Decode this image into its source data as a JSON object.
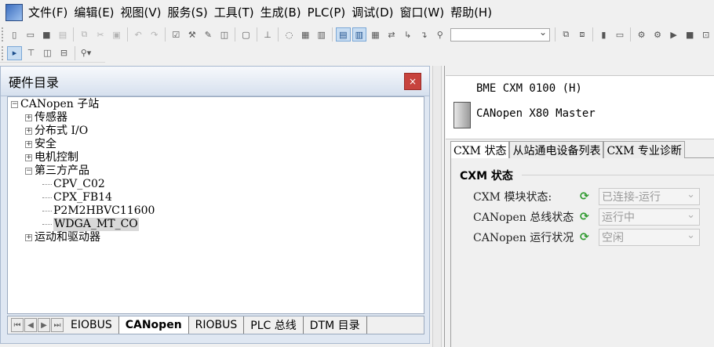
{
  "menu": {
    "items": [
      "文件(F)",
      "编辑(E)",
      "视图(V)",
      "服务(S)",
      "工具(T)",
      "生成(B)",
      "PLC(P)",
      "调试(D)",
      "窗口(W)",
      "帮助(H)"
    ]
  },
  "toolbar": {
    "icons": [
      "new-icon",
      "open-icon",
      "save-icon",
      "print-icon",
      "copy-icon",
      "cut-icon",
      "paste-icon",
      "undo-icon",
      "redo-icon",
      "check-icon",
      "tools-icon",
      "wrench-icon",
      "analyze-icon",
      "monitor-icon",
      "build-icon",
      "project-icon",
      "grid-icon",
      "variables-icon",
      "hardware-catalog-icon",
      "dtm-icon",
      "table-icon",
      "transfer-icon",
      "goto-icon",
      "binoculars-icon"
    ],
    "search_value": "",
    "icons2": [
      "tree-icon",
      "network-icon",
      "columns-icon",
      "rows-icon",
      "zoom-icon"
    ]
  },
  "left_panel": {
    "title": "硬件目录",
    "close_label": "×",
    "tree": {
      "root": "CANopen 子站",
      "categories": [
        {
          "label": "传感器",
          "expanded": false
        },
        {
          "label": "分布式 I/O",
          "expanded": false
        },
        {
          "label": "安全",
          "expanded": false
        },
        {
          "label": "电机控制",
          "expanded": false
        },
        {
          "label": "第三方产品",
          "expanded": true,
          "children": [
            "CPV_C02",
            "CPX_FB14",
            "P2M2HBVC11600",
            "WDGA_MT_CO"
          ]
        },
        {
          "label": "运动和驱动器",
          "expanded": false
        }
      ],
      "selected": "WDGA_MT_CO"
    },
    "tabs": [
      "EIOBUS",
      "CANopen",
      "RIOBUS",
      "PLC 总线",
      "DTM 目录"
    ],
    "active_tab": "CANopen"
  },
  "right_panel": {
    "device_ref": "BME CXM 0100 (H)",
    "device_name": "CANopen X80 Master",
    "tabs": [
      "CXM 状态",
      "从站通电设备列表",
      "CXM 专业诊断"
    ],
    "active_tab": "CXM 状态",
    "group_title": "CXM 状态",
    "rows": [
      {
        "label": "CXM 模块状态:",
        "value": "已连接-运行",
        "icon": "refresh-icon"
      },
      {
        "label": "CANopen 总线状态",
        "value": "运行中",
        "icon": "refresh-icon"
      },
      {
        "label": "CANopen 运行状况",
        "value": "空闲",
        "icon": "refresh-icon"
      }
    ],
    "status_color": "#2f9a2f"
  }
}
